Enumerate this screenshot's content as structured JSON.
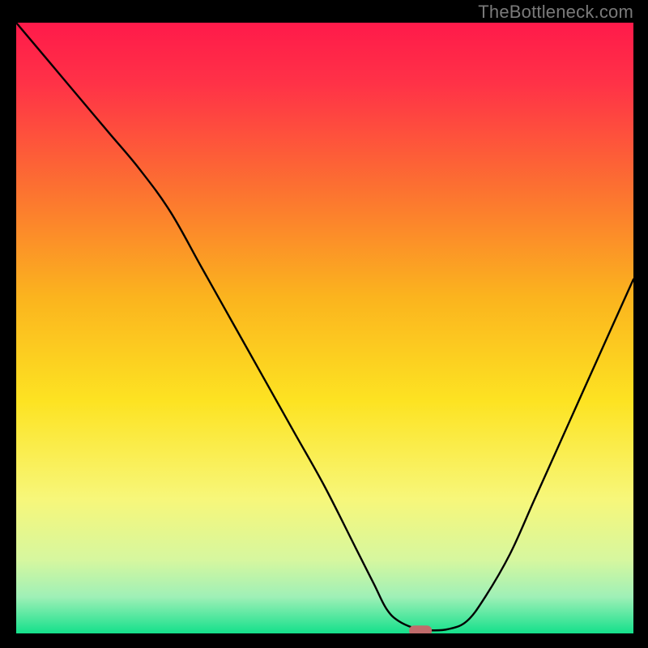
{
  "watermark": "TheBottleneck.com",
  "chart_data": {
    "type": "line",
    "title": "",
    "xlabel": "",
    "ylabel": "",
    "xlim": [
      0,
      100
    ],
    "ylim": [
      0,
      100
    ],
    "grid": false,
    "legend": false,
    "gradient_stops": [
      {
        "pct": 0,
        "color": "#ff1a4a"
      },
      {
        "pct": 10,
        "color": "#ff3247"
      },
      {
        "pct": 28,
        "color": "#fc7430"
      },
      {
        "pct": 45,
        "color": "#fbb41e"
      },
      {
        "pct": 62,
        "color": "#fde322"
      },
      {
        "pct": 78,
        "color": "#f7f77a"
      },
      {
        "pct": 88,
        "color": "#d6f79f"
      },
      {
        "pct": 94,
        "color": "#9ff0b7"
      },
      {
        "pct": 100,
        "color": "#14e08b"
      }
    ],
    "series": [
      {
        "name": "bottleneck-curve",
        "x": [
          0,
          5,
          10,
          15,
          20,
          25,
          30,
          35,
          40,
          45,
          50,
          55,
          58,
          60,
          62,
          65,
          67,
          70,
          73,
          76,
          80,
          84,
          88,
          92,
          96,
          100
        ],
        "y": [
          100,
          94,
          88,
          82,
          76,
          69,
          60,
          51,
          42,
          33,
          24,
          14,
          8,
          4,
          2,
          0.7,
          0.5,
          0.7,
          2,
          6,
          13,
          22,
          31,
          40,
          49,
          58
        ]
      }
    ],
    "marker": {
      "x": 65.5,
      "y": 0.5,
      "color": "#c16b6b"
    }
  }
}
